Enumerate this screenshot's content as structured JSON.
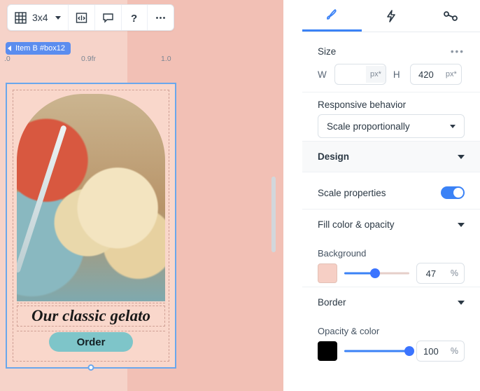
{
  "toolbar": {
    "grid_label": "3x4"
  },
  "tag": {
    "text": "Item B #box12"
  },
  "ruler": {
    "left": ".0",
    "center": "0.9fr",
    "right": "1.0"
  },
  "card": {
    "caption": "Our classic gelato",
    "order_label": "Order"
  },
  "panel": {
    "size_label": "Size",
    "w_label": "W",
    "w_unit": "px*",
    "h_label": "H",
    "h_value": "420",
    "h_unit": "px*",
    "responsive_label": "Responsive behavior",
    "responsive_value": "Scale proportionally",
    "design_label": "Design",
    "scale_props_label": "Scale properties",
    "fill_label": "Fill color & opacity",
    "background_label": "Background",
    "bg_pct": "47",
    "pct_sign": "%",
    "border_label": "Border",
    "opacity_color_label": "Opacity & color",
    "opacity_pct": "100"
  }
}
